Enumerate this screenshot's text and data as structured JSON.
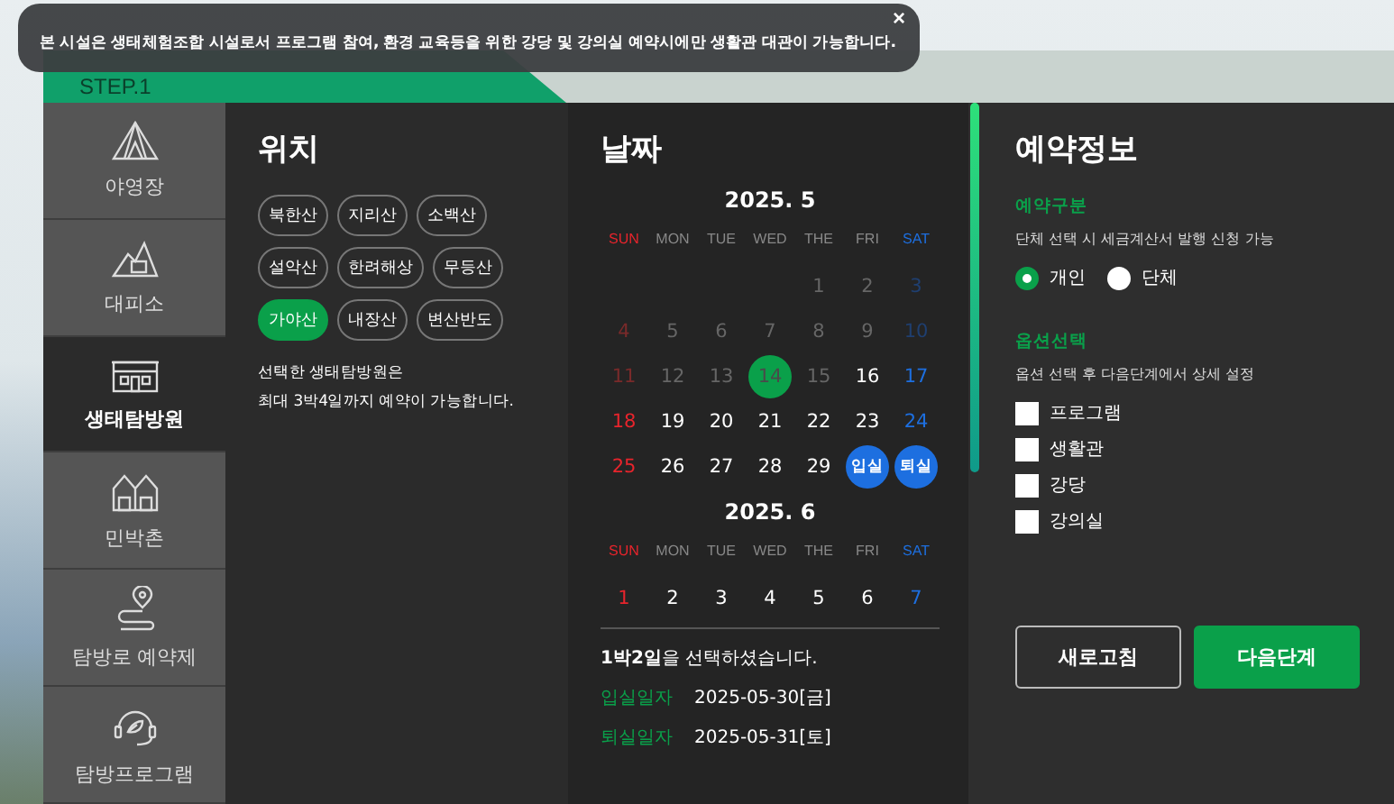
{
  "notice": {
    "text": "본 시설은 생태체험조합 시설로서 프로그램 참여, 환경 교육등을 위한 강당 및 강의실 예약시에만 생활관 대관이 가능합니다.",
    "close": "×"
  },
  "step": {
    "label": "STEP.1"
  },
  "sidebar": {
    "items": [
      {
        "label": "야영장",
        "selected": false
      },
      {
        "label": "대피소",
        "selected": false
      },
      {
        "label": "생태탐방원",
        "selected": true
      },
      {
        "label": "민박촌",
        "selected": false
      },
      {
        "label": "탐방로 예약제",
        "selected": false
      },
      {
        "label": "탐방프로그램",
        "selected": false
      }
    ]
  },
  "location": {
    "title": "위치",
    "options": [
      {
        "label": "북한산",
        "selected": false
      },
      {
        "label": "지리산",
        "selected": false
      },
      {
        "label": "소백산",
        "selected": false
      },
      {
        "label": "설악산",
        "selected": false
      },
      {
        "label": "한려해상",
        "selected": false
      },
      {
        "label": "무등산",
        "selected": false
      },
      {
        "label": "가야산",
        "selected": true
      },
      {
        "label": "내장산",
        "selected": false
      },
      {
        "label": "변산반도",
        "selected": false
      }
    ],
    "note": [
      "선택한 생태탐방원은",
      "최대 3박4일까지 예약이 가능합니다."
    ]
  },
  "calendar": {
    "title": "날짜",
    "months": [
      {
        "title": "2025. 5",
        "weekdays": [
          "SUN",
          "MON",
          "TUE",
          "WED",
          "THE",
          "FRI",
          "SAT"
        ],
        "weeks": [
          [
            {
              "label": "1",
              "disabled": true,
              "today": false,
              "selected": false
            },
            {
              "label": "2",
              "disabled": true,
              "today": false,
              "selected": false
            },
            {
              "label": "3",
              "disabled": true,
              "today": false,
              "selected": false
            }
          ],
          [
            {
              "label": "4",
              "disabled": true,
              "today": false,
              "selected": false
            },
            {
              "label": "5",
              "disabled": true,
              "today": false,
              "selected": false
            },
            {
              "label": "6",
              "disabled": true,
              "today": false,
              "selected": false
            },
            {
              "label": "7",
              "disabled": true,
              "today": false,
              "selected": false
            },
            {
              "label": "8",
              "disabled": true,
              "today": false,
              "selected": false
            },
            {
              "label": "9",
              "disabled": true,
              "today": false,
              "selected": false
            },
            {
              "label": "10",
              "disabled": true,
              "today": false,
              "selected": false
            }
          ],
          [
            {
              "label": "11",
              "disabled": true,
              "today": false,
              "selected": false
            },
            {
              "label": "12",
              "disabled": true,
              "today": false,
              "selected": false
            },
            {
              "label": "13",
              "disabled": true,
              "today": false,
              "selected": false
            },
            {
              "label": "14",
              "disabled": true,
              "today": true,
              "selected": false
            },
            {
              "label": "15",
              "disabled": true,
              "today": false,
              "selected": false
            },
            {
              "label": "16",
              "disabled": false,
              "today": false,
              "selected": false
            },
            {
              "label": "17",
              "disabled": false,
              "today": false,
              "selected": false
            }
          ],
          [
            {
              "label": "18",
              "disabled": false,
              "today": false,
              "selected": false
            },
            {
              "label": "19",
              "disabled": false,
              "today": false,
              "selected": false
            },
            {
              "label": "20",
              "disabled": false,
              "today": false,
              "selected": false
            },
            {
              "label": "21",
              "disabled": false,
              "today": false,
              "selected": false
            },
            {
              "label": "22",
              "disabled": false,
              "today": false,
              "selected": false
            },
            {
              "label": "23",
              "disabled": false,
              "today": false,
              "selected": false
            },
            {
              "label": "24",
              "disabled": false,
              "today": false,
              "selected": false
            }
          ],
          [
            {
              "label": "25",
              "disabled": false,
              "today": false,
              "selected": false
            },
            {
              "label": "26",
              "disabled": false,
              "today": false,
              "selected": false
            },
            {
              "label": "27",
              "disabled": false,
              "today": false,
              "selected": false
            },
            {
              "label": "28",
              "disabled": false,
              "today": false,
              "selected": false
            },
            {
              "label": "29",
              "disabled": false,
              "today": false,
              "selected": false
            },
            {
              "label": "입실",
              "disabled": false,
              "today": false,
              "selected": true
            },
            {
              "label": "퇴실",
              "disabled": false,
              "today": false,
              "selected": true
            }
          ]
        ]
      },
      {
        "title": "2025. 6",
        "weekdays": [
          "SUN",
          "MON",
          "TUE",
          "WED",
          "THE",
          "FRI",
          "SAT"
        ],
        "weeks": [
          [
            {
              "label": "1",
              "disabled": false,
              "today": false,
              "selected": false
            },
            {
              "label": "2",
              "disabled": false,
              "today": false,
              "selected": false
            },
            {
              "label": "3",
              "disabled": false,
              "today": false,
              "selected": false
            },
            {
              "label": "4",
              "disabled": false,
              "today": false,
              "selected": false
            },
            {
              "label": "5",
              "disabled": false,
              "today": false,
              "selected": false
            },
            {
              "label": "6",
              "disabled": false,
              "today": false,
              "selected": false
            },
            {
              "label": "7",
              "disabled": false,
              "today": false,
              "selected": false
            }
          ]
        ]
      }
    ],
    "summary": "**1박2일**을 선택하셨습니다.",
    "dates": [
      {
        "label": "입실일자",
        "value": "2025-05-30[금]"
      },
      {
        "label": "퇴실일자",
        "value": "2025-05-31[토]"
      }
    ]
  },
  "reservation": {
    "title": "예약정보",
    "type_section": {
      "label": "예약구분",
      "hint": "단체 선택 시 세금계산서 발행 신청 가능",
      "options": [
        {
          "label": "개인",
          "selected": true
        },
        {
          "label": "단체",
          "selected": false
        }
      ]
    },
    "option_section": {
      "label": "옵션선택",
      "hint": "옵션 선택 후 다음단계에서 상세 설정",
      "options": [
        {
          "label": "프로그램",
          "checked": false
        },
        {
          "label": "생활관",
          "checked": false
        },
        {
          "label": "강당",
          "checked": false
        },
        {
          "label": "강의실",
          "checked": false
        }
      ]
    },
    "buttons": [
      {
        "label": "새로고침",
        "kind": "secondary"
      },
      {
        "label": "다음단계",
        "kind": "primary"
      }
    ]
  }
}
